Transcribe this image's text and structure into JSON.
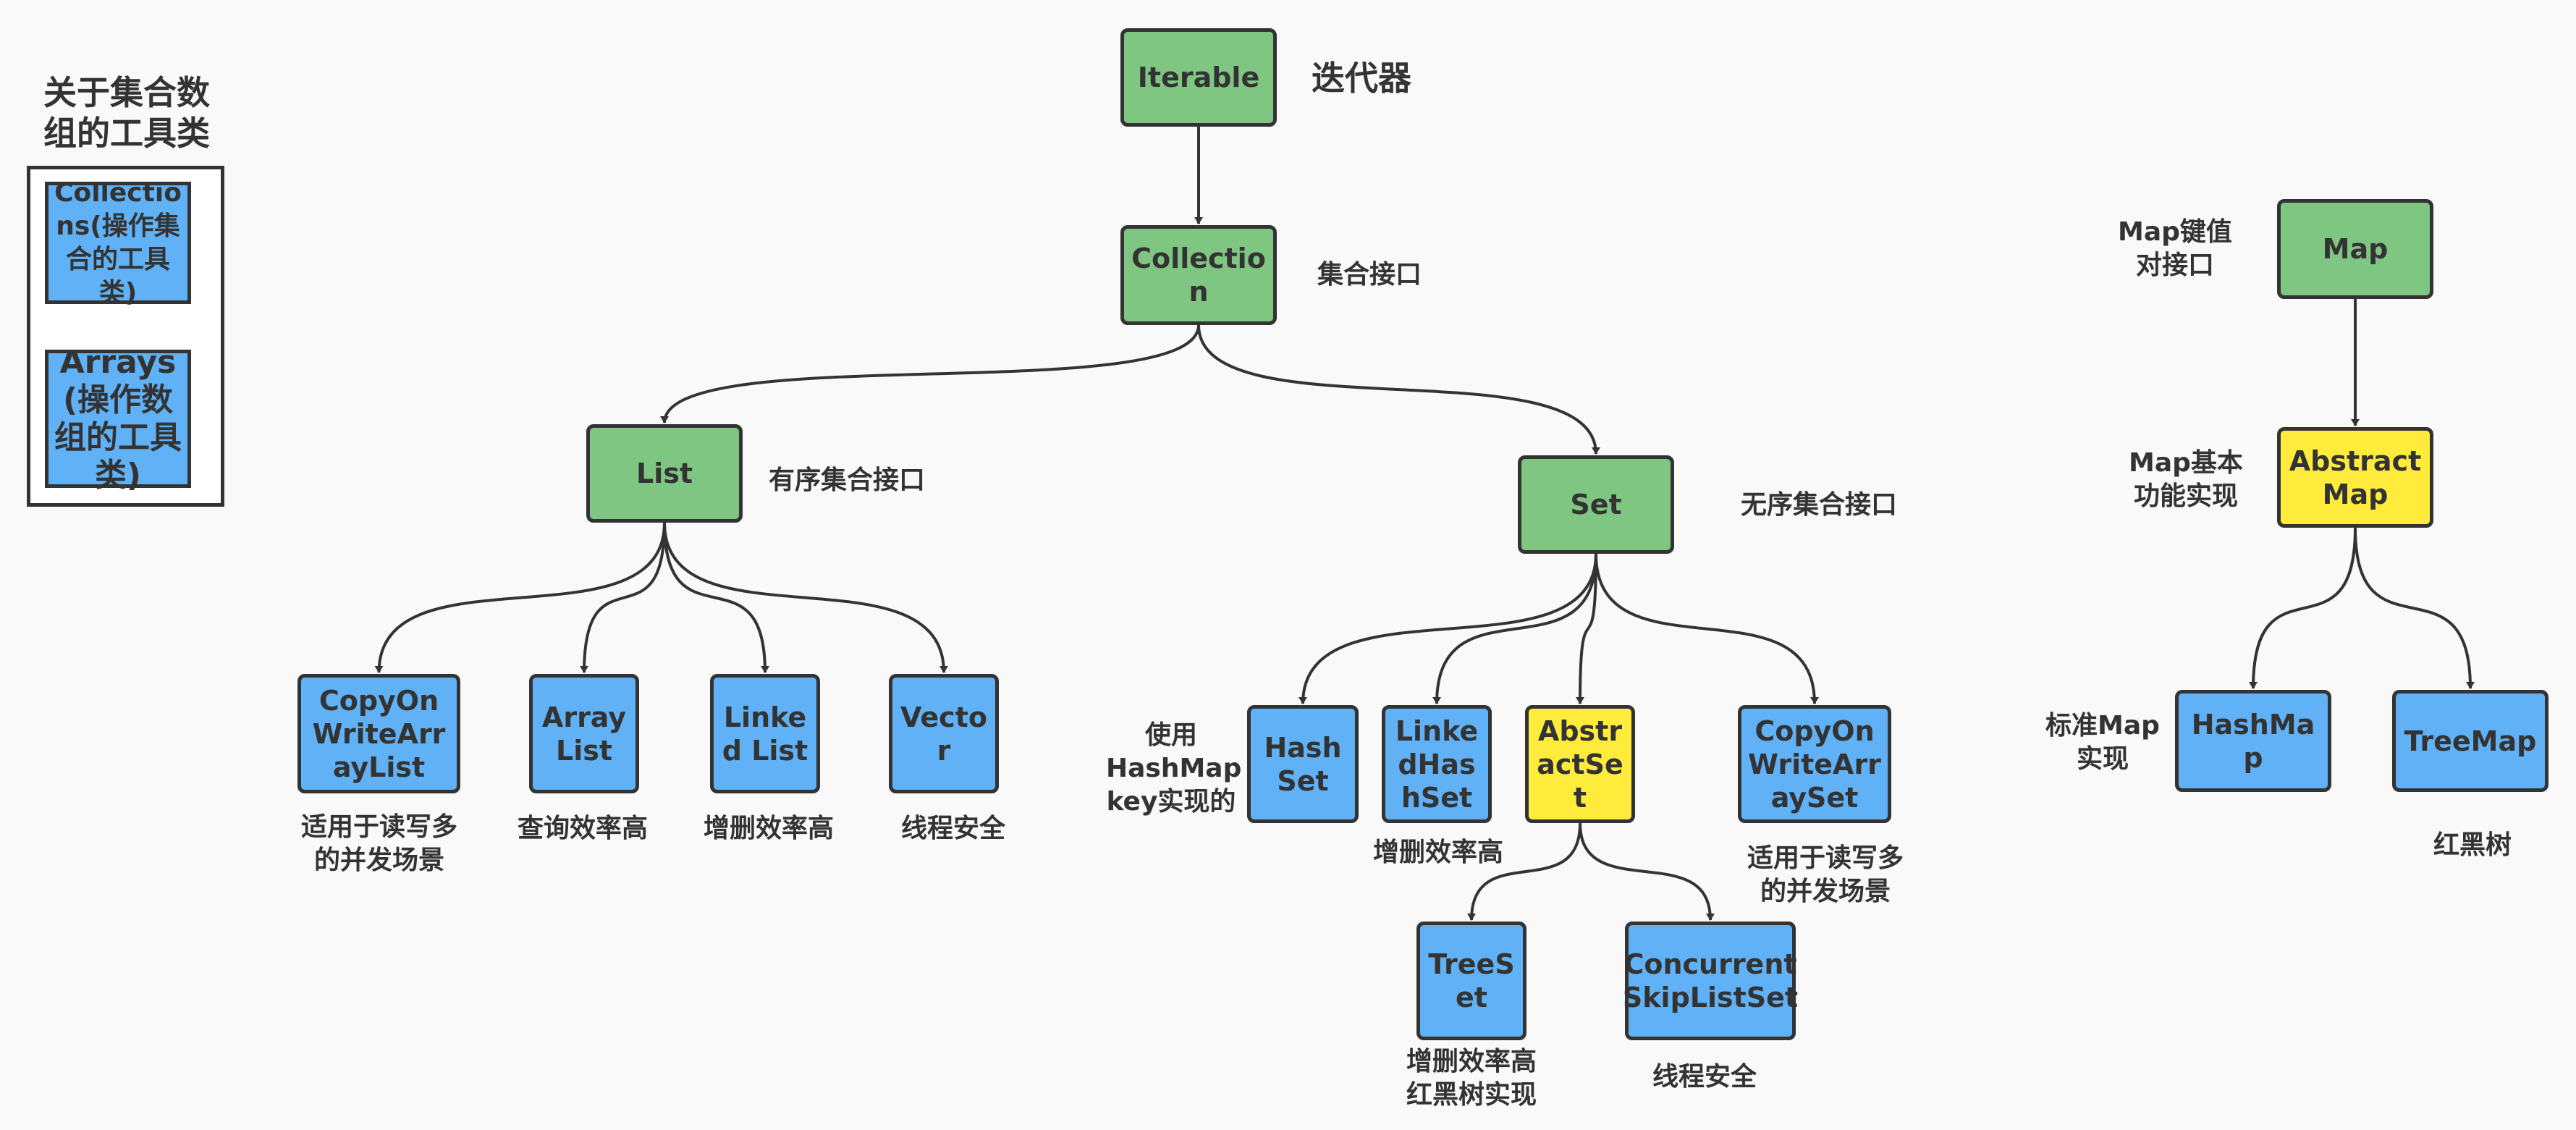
{
  "colors": {
    "interface": "#7fc683",
    "implementation": "#60b1f5",
    "abstract": "#ffeb3b",
    "line": "#333333",
    "background": "#f9f9f9"
  },
  "tools": {
    "title": "关于集合数组的工具类",
    "collections": "Collections(操作集合的工具类)",
    "arrays": "Arrays(操作数组的工具类)"
  },
  "nodes": {
    "iterable": {
      "label": "Iterable",
      "note": "迭代器",
      "kind": "interface"
    },
    "collection": {
      "label": "Collection",
      "note": "集合接口",
      "kind": "interface"
    },
    "list": {
      "label": "List",
      "note": "有序集合接口",
      "kind": "interface"
    },
    "set": {
      "label": "Set",
      "note": "无序集合接口",
      "kind": "interface"
    },
    "map": {
      "label": "Map",
      "note": "Map键值对接口",
      "kind": "interface"
    },
    "abstract_map": {
      "label": "Abstract Map",
      "note": "Map基本功能实现",
      "kind": "abstract"
    },
    "copy_on_write_array_list": {
      "label": "CopyOnWriteArrayList",
      "note": "适用于读写多的并发场景",
      "kind": "implementation"
    },
    "array_list": {
      "label": "Array List",
      "note": "查询效率高",
      "kind": "implementation"
    },
    "linked_list": {
      "label": "Linked List",
      "note": "增删效率高",
      "kind": "implementation"
    },
    "vector": {
      "label": "Vector",
      "note": "线程安全",
      "kind": "implementation"
    },
    "hash_set": {
      "label": "HashSet",
      "note": "使用HashMap key实现的",
      "kind": "implementation"
    },
    "linked_hash_set": {
      "label": "LinkedHashSet",
      "note": "增删效率高",
      "kind": "implementation"
    },
    "abstract_set": {
      "label": "AbstractSet",
      "note": "",
      "kind": "abstract"
    },
    "copy_on_write_array_set": {
      "label": "CopyOnWriteArraySet",
      "note": "适用于读写多的并发场景",
      "kind": "implementation"
    },
    "tree_set": {
      "label": "TreeSet",
      "note": "增删效率高 红黑树实现",
      "kind": "implementation"
    },
    "concurrent_skip_list_set": {
      "label": "Concurrent SkipListSet",
      "note": "线程安全",
      "kind": "implementation"
    },
    "hash_map": {
      "label": "HashMap",
      "note": "标准Map实现",
      "kind": "implementation"
    },
    "tree_map": {
      "label": "TreeMap",
      "note": "红黑树",
      "kind": "implementation"
    }
  },
  "edges": [
    [
      "iterable",
      "collection"
    ],
    [
      "collection",
      "list"
    ],
    [
      "collection",
      "set"
    ],
    [
      "list",
      "copy_on_write_array_list"
    ],
    [
      "list",
      "array_list"
    ],
    [
      "list",
      "linked_list"
    ],
    [
      "list",
      "vector"
    ],
    [
      "set",
      "hash_set"
    ],
    [
      "set",
      "linked_hash_set"
    ],
    [
      "set",
      "abstract_set"
    ],
    [
      "set",
      "copy_on_write_array_set"
    ],
    [
      "abstract_set",
      "tree_set"
    ],
    [
      "abstract_set",
      "concurrent_skip_list_set"
    ],
    [
      "map",
      "abstract_map"
    ],
    [
      "abstract_map",
      "hash_map"
    ],
    [
      "abstract_map",
      "tree_map"
    ]
  ]
}
